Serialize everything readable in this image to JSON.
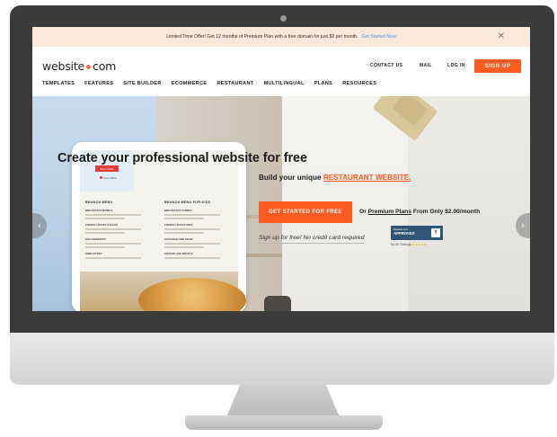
{
  "promo": {
    "text": "Limited Time Offer! Get 12 months of Premium Plan with a free domain for just $2 per month.",
    "link": "Get Started Now",
    "close": "✕"
  },
  "header": {
    "logo_left": "website",
    "logo_right": "com",
    "contact": "CONTACT US",
    "mail": "MAIL",
    "login": "LOG IN",
    "signup": "SIGN UP"
  },
  "nav": [
    "TEMPLATES",
    "FEATURES",
    "SITE BUILDER",
    "ECOMMERCE",
    "RESTAURANT",
    "MULTILINGUAL",
    "PLANS",
    "RESOURCES"
  ],
  "hero": {
    "headline": "Create your professional website for free",
    "sub_prefix": "Build your unique ",
    "sub_accent": "RESTAURANT WEBSITE.",
    "cta": "GET STARTED FOR FREE",
    "premium_prefix": "Or ",
    "premium_link": "Premium Plans",
    "premium_suffix": " From Only $2.00/month",
    "no_credit": "Sign up for free! No credit card required",
    "badge_top": "Website.com",
    "badge_main": "APPROVED",
    "badge_logo": "Y",
    "ratings": "65.2K Ratings",
    "stars": "★★★★★",
    "arrow_left": "‹",
    "arrow_right": "›"
  },
  "tablet": {
    "pill": "Place Order",
    "brand": "OpenTable",
    "menu_left": "BRUNCH MENU",
    "menu_right": "BRUNCH MENU FOR KIDS",
    "items_left": [
      "BREAKFAST BOWLS",
      "FRENCH TOAST & EGGS",
      "EGG BENEDICT",
      "OMELETTES"
    ],
    "items_right": [
      "BREAKFAST COMBO",
      "FRENCH TOAST KIDS",
      "SAUSAGE AND EGGS",
      "CHOCOLATE WAFFLE"
    ]
  }
}
